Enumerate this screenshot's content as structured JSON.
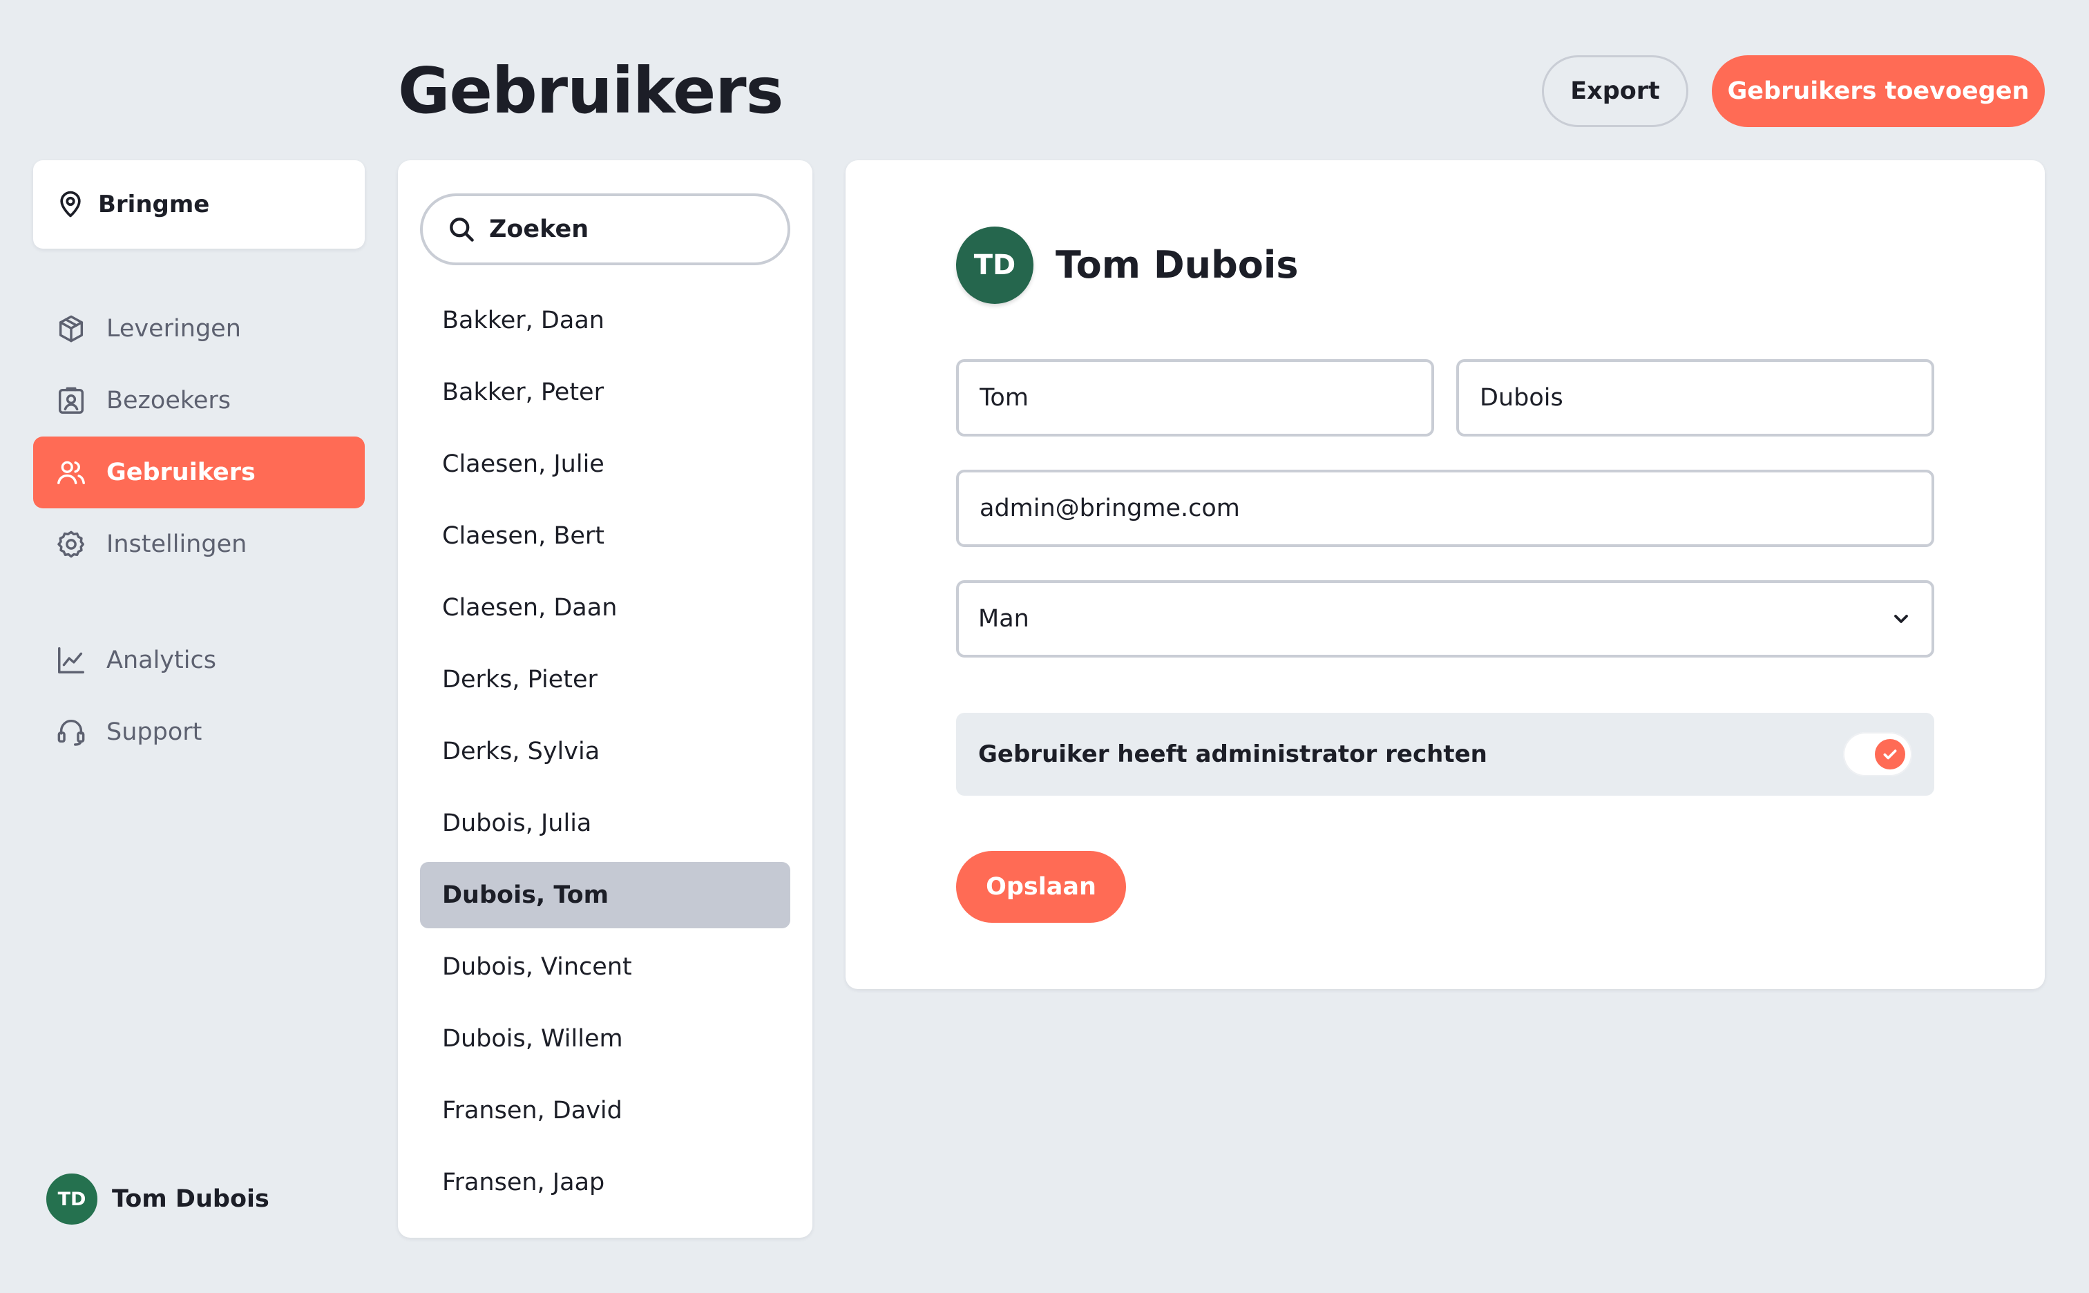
{
  "header": {
    "title": "Gebruikers",
    "export_label": "Export",
    "add_label": "Gebruikers toevoegen"
  },
  "sidebar": {
    "location": "Bringme",
    "nav": [
      {
        "label": "Leveringen",
        "icon": "package-icon"
      },
      {
        "label": "Bezoekers",
        "icon": "visitor-badge-icon"
      },
      {
        "label": "Gebruikers",
        "icon": "users-icon",
        "active": true
      },
      {
        "label": "Instellingen",
        "icon": "gear-icon"
      }
    ],
    "nav_secondary": [
      {
        "label": "Analytics",
        "icon": "chart-icon"
      },
      {
        "label": "Support",
        "icon": "headset-icon"
      }
    ],
    "profile": {
      "initials": "TD",
      "name": "Tom Dubois"
    }
  },
  "list": {
    "search_placeholder": "Zoeken",
    "users": [
      "Bakker, Daan",
      "Bakker, Peter",
      "Claesen, Julie",
      "Claesen, Bert",
      "Claesen, Daan",
      "Derks, Pieter",
      "Derks, Sylvia",
      "Dubois, Julia",
      "Dubois, Tom",
      "Dubois, Vincent",
      "Dubois, Willem",
      "Fransen, David",
      "Fransen, Jaap"
    ],
    "selected_index": 8
  },
  "detail": {
    "initials": "TD",
    "name": "Tom Dubois",
    "first_name": "Tom",
    "last_name": "Dubois",
    "email": "admin@bringme.com",
    "gender": "Man",
    "admin_label": "Gebruiker heeft administrator rechten",
    "admin_enabled": true,
    "save_label": "Opslaan"
  },
  "colors": {
    "accent": "#ff6b55",
    "avatar": "#25714f",
    "background": "#e8ecf0",
    "selected_row": "#c5c9d3"
  }
}
